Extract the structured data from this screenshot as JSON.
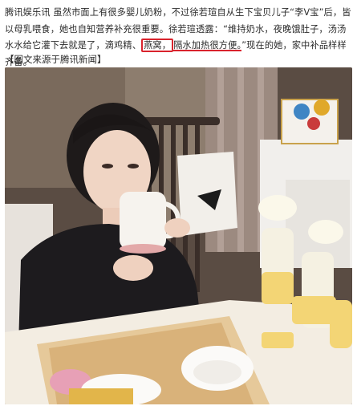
{
  "article": {
    "lead": "腾讯娱乐讯 虽然市面上有很多婴儿奶粉，不过徐若瑄自从生下宝贝儿子“李V宝”后，皆以母乳喂食，她也自知营养补充很重要。徐若瑄透露：",
    "quote_part1": "“维持奶水，夜晚饿肚子，汤汤水水给它灌下去就是了，滴鸡精、",
    "quote_boxed": "燕窝，",
    "quote_part2": "隔水加热很方便。",
    "tail": "”现在的她，家中补品样样齐备。"
  },
  "source": "【图文来源于腾讯新闻】",
  "photo": {
    "description_icon": "photo-image",
    "colors": {
      "accent": "#d9232d",
      "wall": "#efece6",
      "table": "#e9d9bc",
      "sweater": "#1d1b1e"
    }
  }
}
